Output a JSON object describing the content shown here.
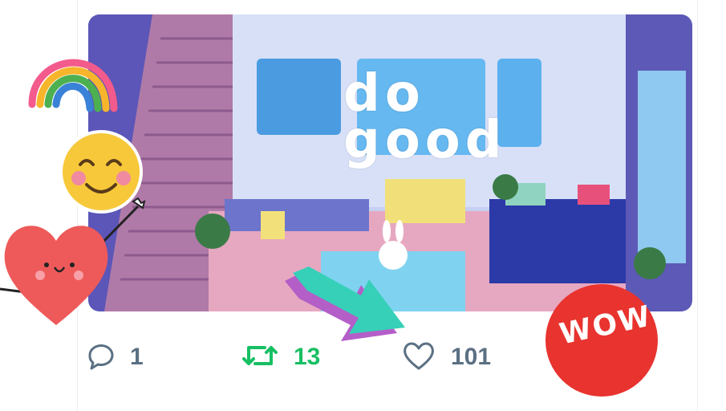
{
  "media": {
    "overlay_text_line1": "do",
    "overlay_text_line2": "good"
  },
  "actions": {
    "reply_count": "1",
    "retweet_count": "13",
    "like_count": "101"
  },
  "stickers": {
    "wow_label": "WOW",
    "rainbow": "rainbow-sticker",
    "smiley": "smiling-face-sticker",
    "heart": "heart-character-sticker",
    "arrow": "arrow-sticker"
  },
  "colors": {
    "retweet_green": "#17bf63",
    "icon_gray": "#5b7083",
    "wow_red": "#e8332f"
  }
}
